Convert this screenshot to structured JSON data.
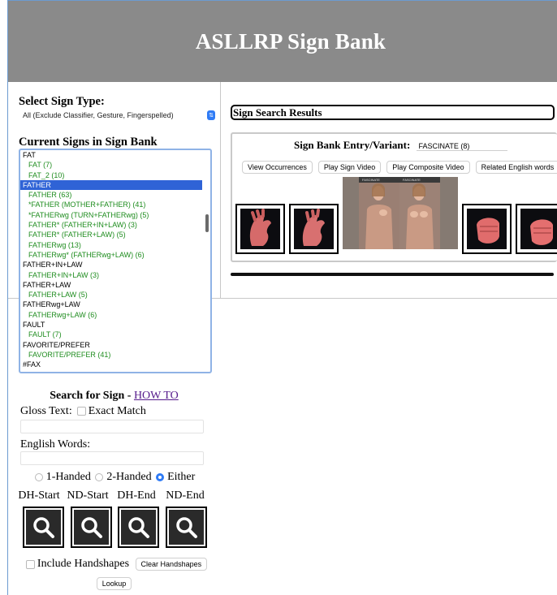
{
  "app": {
    "title": "ASLLRP Sign Bank"
  },
  "left": {
    "select_type_label": "Select Sign Type:",
    "select_type_value": "All (Exclude Classifier, Gesture, Fingerspelled)",
    "current_signs_label": "Current Signs in Sign Bank",
    "list": [
      {
        "text": "FAT",
        "kind": "head"
      },
      {
        "text": "FAT (7)",
        "kind": "child"
      },
      {
        "text": "FAT_2 (10)",
        "kind": "child"
      },
      {
        "text": "FATHER",
        "kind": "selected"
      },
      {
        "text": "FATHER (63)",
        "kind": "child"
      },
      {
        "text": "*FATHER (MOTHER+FATHER) (41)",
        "kind": "child"
      },
      {
        "text": "*FATHERwg (TURN+FATHERwg) (5)",
        "kind": "child"
      },
      {
        "text": "FATHER* (FATHER+IN+LAW) (3)",
        "kind": "child"
      },
      {
        "text": "FATHER* (FATHER+LAW) (5)",
        "kind": "child"
      },
      {
        "text": "FATHERwg (13)",
        "kind": "child"
      },
      {
        "text": "FATHERwg* (FATHERwg+LAW) (6)",
        "kind": "child"
      },
      {
        "text": "FATHER+IN+LAW",
        "kind": "head"
      },
      {
        "text": "FATHER+IN+LAW (3)",
        "kind": "child"
      },
      {
        "text": "FATHER+LAW",
        "kind": "head"
      },
      {
        "text": "FATHER+LAW (5)",
        "kind": "child"
      },
      {
        "text": "FATHERwg+LAW",
        "kind": "head"
      },
      {
        "text": "FATHERwg+LAW (6)",
        "kind": "child"
      },
      {
        "text": "FAULT",
        "kind": "head"
      },
      {
        "text": "FAULT (7)",
        "kind": "child"
      },
      {
        "text": "FAVORITE/PREFER",
        "kind": "head"
      },
      {
        "text": "FAVORITE/PREFER (41)",
        "kind": "child"
      },
      {
        "text": "#FAX",
        "kind": "head"
      }
    ],
    "search": {
      "title": "Search for Sign",
      "separator": " - ",
      "howto": "HOW TO",
      "gloss_label": "Gloss Text:",
      "exact_match": "Exact Match",
      "english_label": "English Words:",
      "radio_one": "1-Handed",
      "radio_two": "2-Handed",
      "radio_either": "Either",
      "selected_radio": "Either",
      "hs_labels": [
        "DH-Start",
        "ND-Start",
        "DH-End",
        "ND-End"
      ],
      "include_handshapes": "Include Handshapes",
      "clear_handshapes": "Clear Handshapes",
      "lookup": "Lookup"
    }
  },
  "right": {
    "results_title": "Sign Search Results",
    "entry_label": "Sign Bank Entry/Variant:",
    "entry_value": "FASCINATE (8)",
    "buttons": [
      "View Occurrences",
      "Play Sign Video",
      "Play Composite Video",
      "Related English words"
    ],
    "video_caption": "FASCINATE"
  },
  "colors": {
    "header_bg": "#8a8a8a",
    "selected_row": "#2f63d6",
    "child_text": "#1e8c1e",
    "radio_accent": "#2f7bf5"
  }
}
